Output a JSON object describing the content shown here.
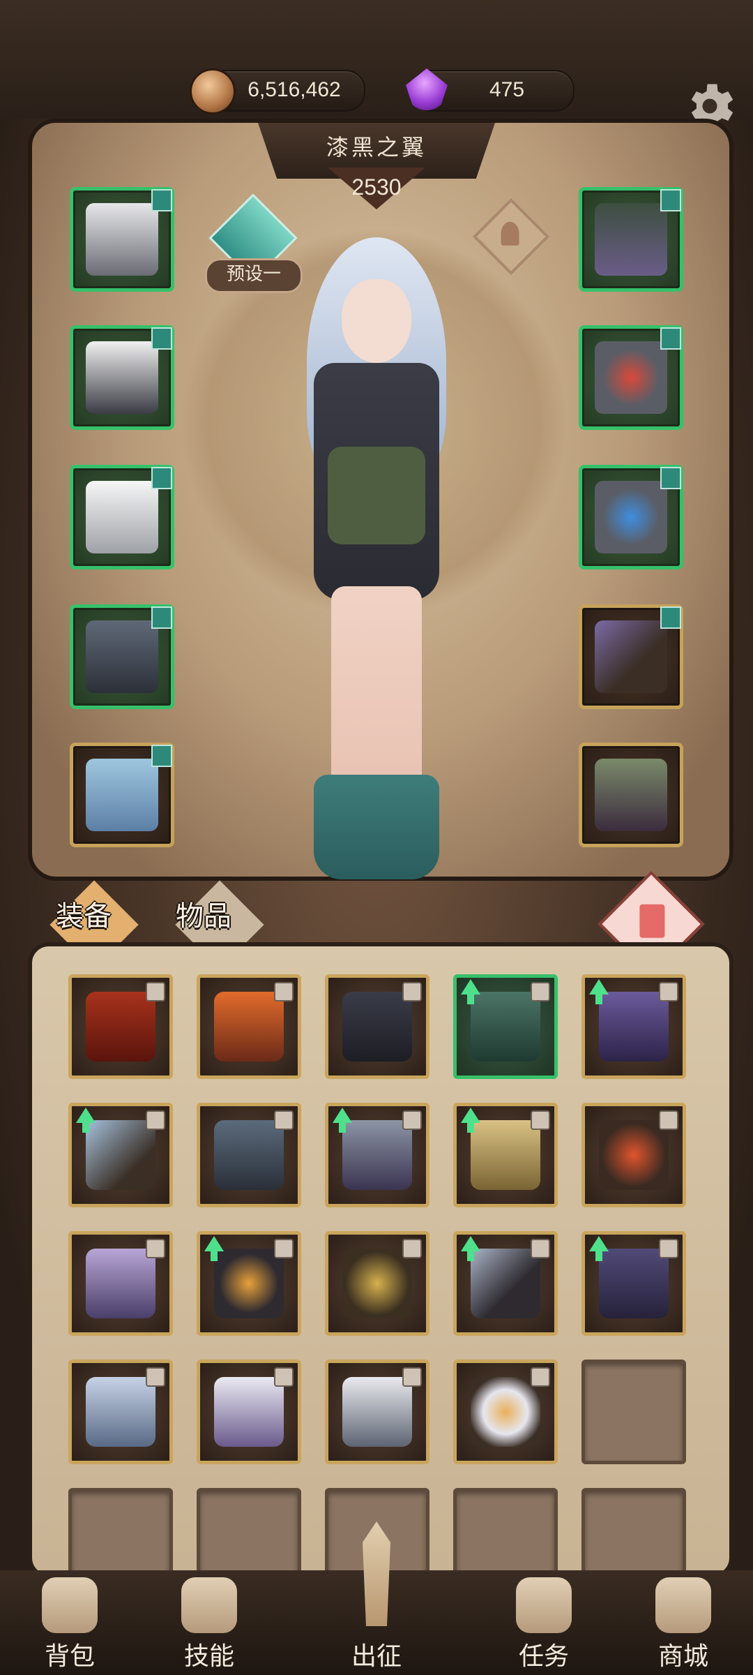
{
  "resources": {
    "gold": "6,516,462",
    "gems": "475"
  },
  "character": {
    "name": "漆黑之翼",
    "power": "2530"
  },
  "preset": {
    "label": "预设一"
  },
  "tabs": {
    "equipment": "装备",
    "items": "物品"
  },
  "nav": {
    "bag": "背包",
    "skills": "技能",
    "battle": "出征",
    "quests": "任务",
    "shop": "商城"
  },
  "colors": {
    "rare": "#35c16a",
    "epic": "#c9a55c"
  },
  "icons": {
    "gold": "gold-coin-icon",
    "gem": "purple-gem-icon",
    "settings": "gear-icon",
    "trash": "trash-icon"
  }
}
